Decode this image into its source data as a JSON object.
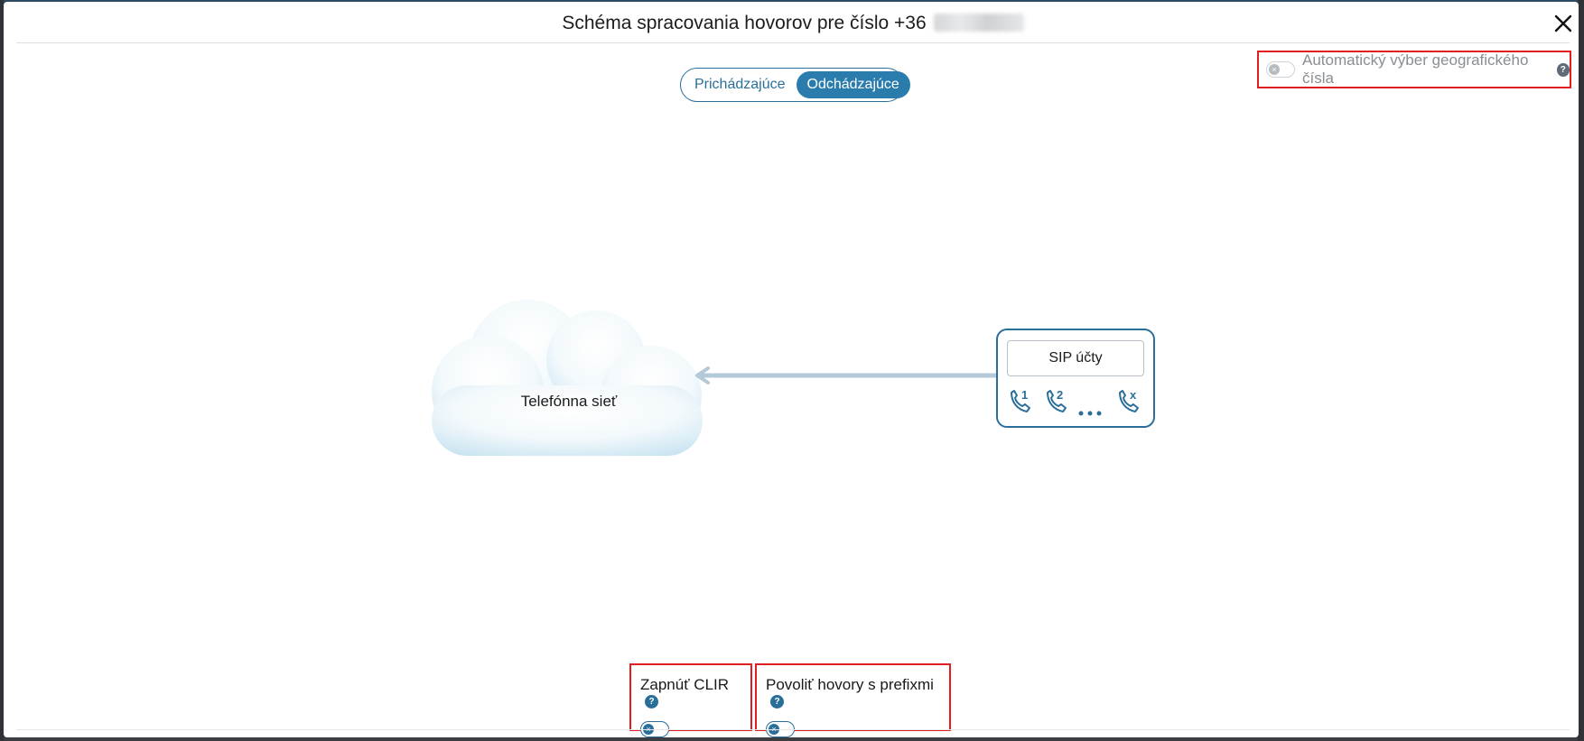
{
  "modal": {
    "title": "Schéma spracovania hovorov pre číslo +36"
  },
  "auto_geo": {
    "label": "Automatický výber geografického čísla",
    "enabled": false
  },
  "direction_tabs": [
    {
      "label": "Prichádzajúce",
      "active": false
    },
    {
      "label": "Odchádzajúce",
      "active": true
    }
  ],
  "diagram": {
    "cloud_label": "Telefónna sieť",
    "sip_label": "SIP účty",
    "sip_lines": [
      "1",
      "2",
      "x"
    ]
  },
  "options": {
    "clir_label": "Zapnúť CLIR",
    "prefix_label": "Povoliť hovory s prefixmi"
  },
  "icons": {
    "close": "close-icon",
    "help": "question-circle-icon",
    "phone": "phone-outgoing-icon",
    "toggle_off": "x-mark-icon"
  },
  "colors": {
    "accent": "#2a7cad",
    "highlight_border": "#e02020",
    "cloud_fill": "#dff0f8",
    "arrow": "#b3cad9"
  }
}
